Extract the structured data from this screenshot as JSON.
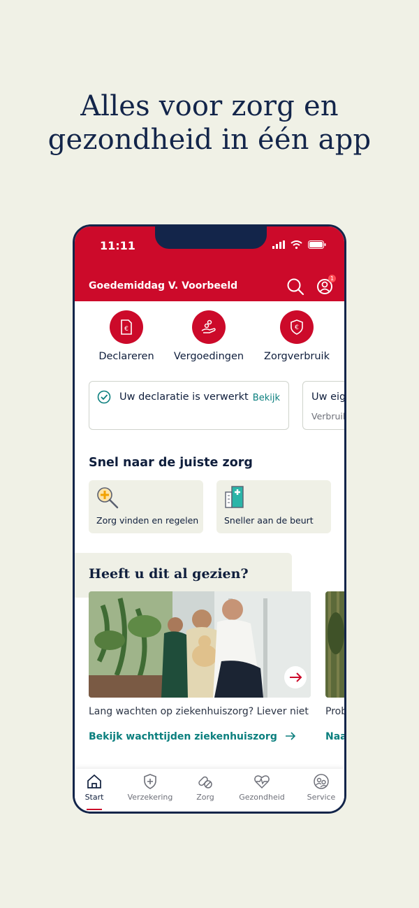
{
  "headline": [
    "Alles voor zorg en",
    "gezondheid in één app"
  ],
  "status_bar": {
    "time": "11:11"
  },
  "header": {
    "greeting": "Goedemiddag V. Voorbeeld",
    "notification_count": "1"
  },
  "quick_actions": [
    {
      "label": "Declareren",
      "icon": "receipt-euro-icon"
    },
    {
      "label": "Vergoedingen",
      "icon": "hand-coins-icon"
    },
    {
      "label": "Zorgverbruik",
      "icon": "shield-euro-icon"
    }
  ],
  "notifications": [
    {
      "title": "Uw declaratie is verwerkt",
      "link": "Bekijk"
    },
    {
      "title": "Uw eig",
      "subtitle": "Verbruik"
    }
  ],
  "care_section": {
    "title": "Snel naar de juiste zorg",
    "cards": [
      {
        "label": "Zorg vinden en regelen",
        "icon": "magnifier-plus-icon"
      },
      {
        "label": "Sneller aan de beurt",
        "icon": "hospital-building-icon"
      }
    ]
  },
  "seen_section": {
    "title": "Heeft u dit al gezien?",
    "articles": [
      {
        "caption": "Lang wachten op ziekenhuiszorg? Liever niet",
        "link": "Bekijk wachttijden ziekenhuiszorg"
      },
      {
        "caption": "Prob",
        "link": "Naa"
      }
    ]
  },
  "tabs": [
    {
      "label": "Start",
      "icon": "home-icon",
      "active": true
    },
    {
      "label": "Verzekering",
      "icon": "shield-plus-icon"
    },
    {
      "label": "Zorg",
      "icon": "pills-icon"
    },
    {
      "label": "Gezondheid",
      "icon": "heart-pulse-icon"
    },
    {
      "label": "Service",
      "icon": "service-people-icon"
    }
  ],
  "colors": {
    "brand_red": "#cc0a2a",
    "teal_link": "#0b7f7e",
    "navy": "#13254a",
    "background": "#f0f1e6"
  }
}
